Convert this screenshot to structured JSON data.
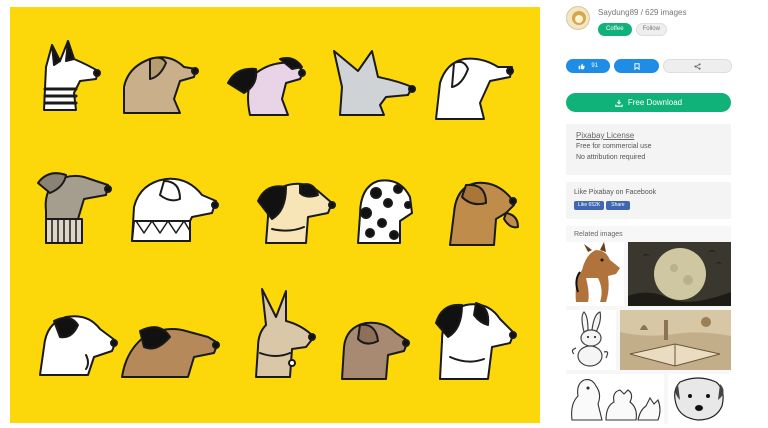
{
  "author": {
    "name_line": "Saydung89 / 629 images",
    "coffee_label": "Coffee",
    "follow_label": "Follow"
  },
  "actions": {
    "like_count": "91",
    "like_icon": "thumbs-up-icon",
    "save_icon": "bookmark-icon",
    "share_icon": "share-icon"
  },
  "download": {
    "label": "Free Download",
    "icon": "download-icon"
  },
  "license": {
    "title": "Pixabay License",
    "lines": [
      "Free for commercial use",
      "No attribution required"
    ]
  },
  "facebook": {
    "title": "Like Pixabay on Facebook",
    "like_label": "Like 652K",
    "share_label": "Share"
  },
  "related": {
    "title": "Related images"
  },
  "colors": {
    "main_background": "#fcd80b",
    "accent_green": "#10b27a",
    "accent_blue": "#1f8ce6",
    "facebook_blue": "#4267b2"
  }
}
